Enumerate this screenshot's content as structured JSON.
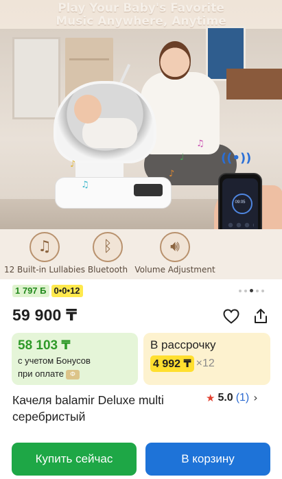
{
  "hero": {
    "headline_line1": "Play Your Baby's Favorite",
    "headline_line2": "Music Anywhere, Anytime",
    "phone_time": "09:05",
    "features": [
      {
        "icon": "music-notes-icon",
        "label": "12 Built-in Lullabies"
      },
      {
        "icon": "bluetooth-icon",
        "label": "Bluetooth"
      },
      {
        "icon": "speaker-volume-icon",
        "label": "Volume Adjustment"
      }
    ],
    "gallery": {
      "count": 5,
      "active_index": 3
    }
  },
  "product": {
    "badges": {
      "bonus": "1 797 Б",
      "installment": "0•0•12"
    },
    "price": "59 900 ₸",
    "bonus_box": {
      "price": "58 103 ₸",
      "note_line1": "с учетом Бонусов",
      "note_line2": "при оплате",
      "chip": "Ф"
    },
    "installment_box": {
      "title": "В рассрочку",
      "amount": "4 992 ₸",
      "months": "×12"
    },
    "title": "Качеля balamir Deluxe multi серебристый",
    "rating": {
      "value": "5.0",
      "count": "(1)"
    },
    "actions": {
      "buy_now": "Купить сейчас",
      "add_to_cart": "В корзину"
    }
  },
  "colors": {
    "buy_button": "#1ea746",
    "cart_button": "#1e73d8",
    "bonus_green": "#2f9a29",
    "installment_yellow": "#ffdf2f",
    "rating_star": "#e2402f",
    "link_blue": "#2d6bd1"
  }
}
